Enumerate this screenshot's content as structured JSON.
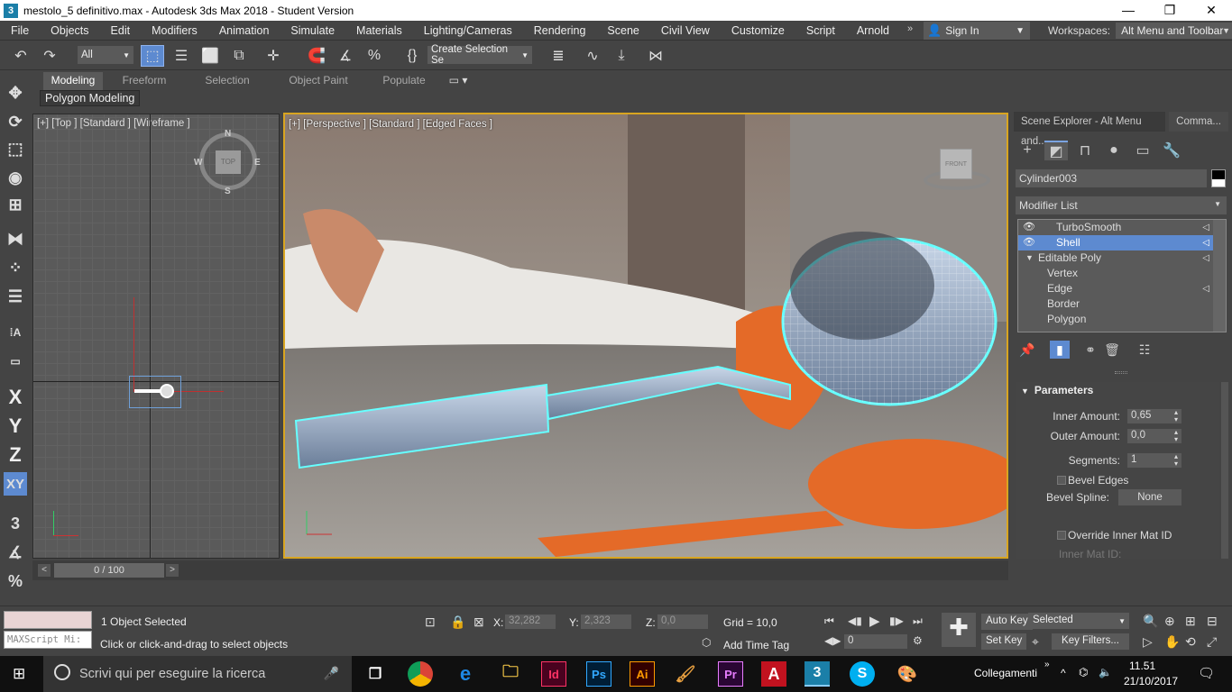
{
  "window": {
    "title": "mestolo_5 definitivo.max - Autodesk 3ds Max 2018 - Student Version",
    "app_icon": "3"
  },
  "menu": [
    "File",
    "Objects",
    "Edit",
    "Modifiers",
    "Animation",
    "Simulate",
    "Materials",
    "Lighting/Cameras",
    "Rendering",
    "Scene",
    "Civil View",
    "Customize",
    "Script",
    "Arnold"
  ],
  "signin": {
    "label": "Sign In"
  },
  "workspaces": {
    "label": "Workspaces:",
    "value": "Alt Menu and Toolbar"
  },
  "toolbar": {
    "filter": "All",
    "selection_set": "Create Selection Se"
  },
  "ribbon": {
    "tabs": [
      "Modeling",
      "Freeform",
      "Selection",
      "Object Paint",
      "Populate"
    ],
    "active_tab": "Modeling",
    "sub_label": "Polygon Modeling"
  },
  "left_tools": {
    "x": "X",
    "y": "Y",
    "z": "Z",
    "xy": "XY"
  },
  "viewports": {
    "top": {
      "label": "[+] [Top ] [Standard ] [Wireframe ]",
      "compass": {
        "n": "N",
        "s": "S",
        "e": "E",
        "w": "W",
        "cube": "TOP"
      }
    },
    "perspective": {
      "label": "[+] [Perspective ] [Standard ] [Edged Faces ]",
      "cube": "FRONT"
    }
  },
  "command_panel": {
    "tabs": [
      "Scene Explorer - Alt Menu and...",
      "Comma..."
    ],
    "object_name": "Cylinder003",
    "modifier_list": "Modifier List",
    "stack": [
      {
        "label": "TurboSmooth",
        "eye": true,
        "selected": false,
        "indent": 1
      },
      {
        "label": "Shell",
        "eye": true,
        "selected": true,
        "indent": 1
      },
      {
        "label": "Editable Poly",
        "eye": false,
        "selected": false,
        "indent": 0,
        "expanded": true
      },
      {
        "label": "Vertex",
        "eye": false,
        "selected": false,
        "indent": 2
      },
      {
        "label": "Edge",
        "eye": false,
        "selected": false,
        "indent": 2
      },
      {
        "label": "Border",
        "eye": false,
        "selected": false,
        "indent": 2
      },
      {
        "label": "Polygon",
        "eye": false,
        "selected": false,
        "indent": 2
      }
    ],
    "parameters": {
      "title": "Parameters",
      "inner_amount_label": "Inner Amount:",
      "inner_amount": "0,65",
      "outer_amount_label": "Outer Amount:",
      "outer_amount": "0,0",
      "segments_label": "Segments:",
      "segments": "1",
      "bevel_edges": "Bevel Edges",
      "bevel_spline_label": "Bevel Spline:",
      "bevel_spline": "None",
      "override_inner": "Override Inner Mat ID",
      "inner_mat_id": "Inner Mat ID:"
    }
  },
  "timeline": {
    "position": "0 / 100"
  },
  "status": {
    "maxscript": "MAXScript Mi:",
    "selected": "1 Object Selected",
    "prompt": "Click or click-and-drag to select objects",
    "x_label": "X:",
    "x": "32,282",
    "y_label": "Y:",
    "y": "2,323",
    "z_label": "Z:",
    "z": "0,0",
    "grid": "Grid = 10,0",
    "add_time_tag": "Add Time Tag",
    "auto_key": "Auto Key",
    "set_key": "Set Key",
    "key_mode": "Selected",
    "key_filters": "Key Filters...",
    "frame": "0"
  },
  "taskbar": {
    "search": "Scrivi qui per eseguire la ricerca",
    "tray_label": "Collegamenti",
    "time": "11.51",
    "date": "21/10/2017"
  }
}
